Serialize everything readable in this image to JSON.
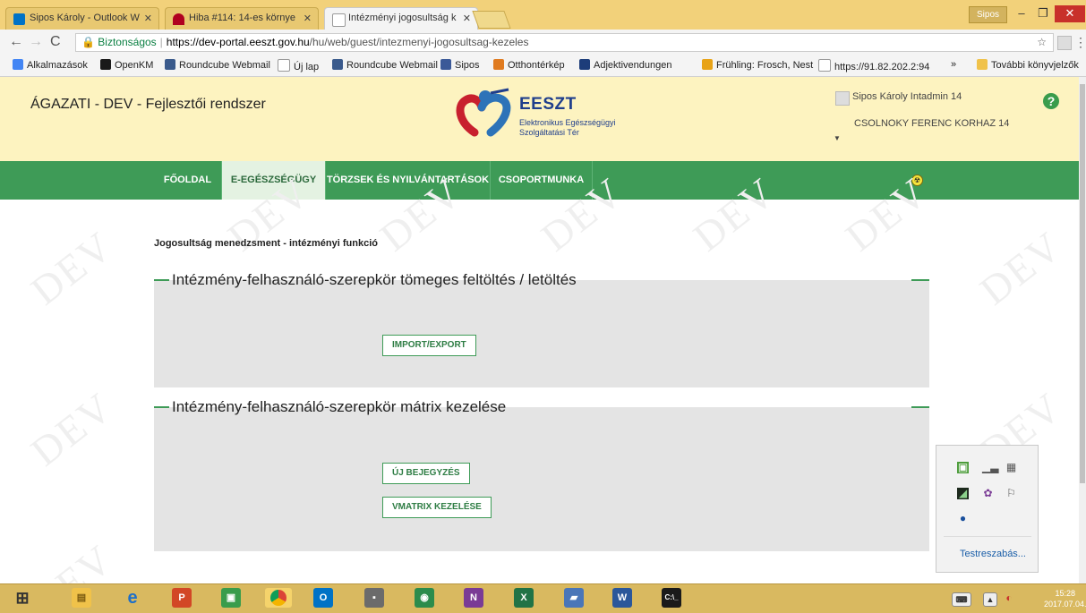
{
  "browser": {
    "tabs": [
      {
        "title": "Sipos Károly - Outlook W",
        "icon_color": "#0072c6"
      },
      {
        "title": "Hiba #114: 14-es környe",
        "icon_color": "#b00020"
      },
      {
        "title": "Intézményi jogosultság k",
        "icon_color": "#777777"
      }
    ],
    "window_user": "Sipos",
    "window_buttons": {
      "minimize": "–",
      "maximize": "❐",
      "close": "✕"
    },
    "address": {
      "secure_label": "Biztonságos",
      "url_scheme_host": "https://dev-portal.eeszt.gov.hu",
      "url_path": "/hu/web/guest/intezmenyi-jogosultsag-kezeles"
    },
    "bookmarks": [
      {
        "label": "Alkalmazások",
        "icon_color": "#4285f4"
      },
      {
        "label": "OpenKM",
        "icon_color": "#1a1a1a"
      },
      {
        "label": "Roundcube Webmail",
        "icon_color": "#3a5a8c"
      },
      {
        "label": "Új lap",
        "icon_color": "#bbbbbb"
      },
      {
        "label": "Roundcube Webmail",
        "icon_color": "#3a5a8c"
      },
      {
        "label": "Sipos",
        "icon_color": "#3b5998"
      },
      {
        "label": "Otthontérkép",
        "icon_color": "#e07b20"
      },
      {
        "label": "Adjektivendungen",
        "icon_color": "#1d3d7a"
      },
      {
        "label": "Frühling: Frosch, Nest",
        "icon_color": "#e8a317"
      },
      {
        "label": "https://91.82.202.2:94",
        "icon_color": "#bbbbbb"
      }
    ],
    "bookmarks_more": "»",
    "bookmarks_other": "További könyvjelzők"
  },
  "portal": {
    "system_name": "ÁGAZATI - DEV - Fejlesztői rendszer",
    "logo": {
      "title": "EESZT",
      "subtitle_line1": "Elektronikus Egészségügyi",
      "subtitle_line2": "Szolgáltatási Tér"
    },
    "user": {
      "name": "Sipos Károly Intadmin 14",
      "organization": "CSOLNOKY FERENC KORHAZ 14"
    },
    "help_label": "?",
    "nav": [
      {
        "label": "FŐOLDAL",
        "active": false
      },
      {
        "label": "E-EGÉSZSÉGÜGY",
        "active": true
      },
      {
        "label": "TÖRZSEK ÉS NYILVÁNTARTÁSOK",
        "active": false
      },
      {
        "label": "CSOPORTMUNKA",
        "active": false
      }
    ],
    "watermark": "DEV",
    "breadcrumb": "Jogosultság menedzsment - intézményi funkció",
    "sections": [
      {
        "title": "Intézmény-felhasználó-szerepkör tömeges feltöltés / letöltés",
        "buttons": [
          "IMPORT/EXPORT"
        ]
      },
      {
        "title": "Intézmény-felhasználó-szerepkör mátrix kezelése",
        "buttons": [
          "ÚJ BEJEGYZÉS",
          "VMATRIX KEZELÉSE"
        ]
      }
    ]
  },
  "tray_popup": {
    "customize_link": "Testreszabás..."
  },
  "taskbar": {
    "clock_time": "15:28",
    "clock_date": "2017.07.04."
  },
  "colors": {
    "accent_green": "#3e9b57",
    "header_bg": "#fdf3c0",
    "brand_blue": "#1f3e8c"
  }
}
